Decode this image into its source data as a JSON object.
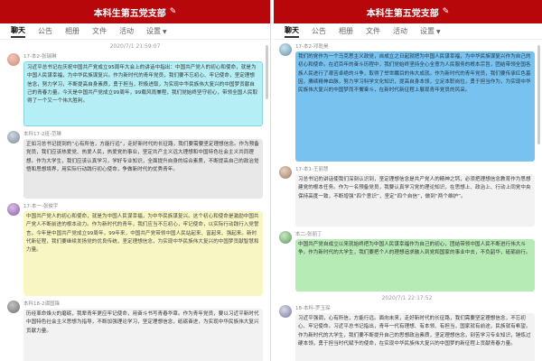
{
  "left": {
    "title": "本科生第五党支部",
    "tabs": [
      "聊天",
      "公告",
      "相册",
      "文件",
      "活动",
      "设置"
    ],
    "time": "2020/7/1 21:59:07",
    "messages": [
      {
        "sender": "17-本2-张瑞琳",
        "text": "习近平总书记在庆祝中国共产党成立95周年大会上的讲话中指出：中国共产党人的初心和使命，就是为中国人民谋幸福，为中华民族谋复兴。作为新时代的青年党员，我们要不忘初心、牢记使命，坚定理想信念，努力学习，不断提高自身素质，勇于担当，积极进取，为实现中华民族伟大复兴的中国梦贡献自己的青春力量。今天是中国共产党成立99周年，99载风雨兼程，我们党始终坚守初心，带领全国人民取得了一个又一个伟大胜利。"
      },
      {
        "sender": "本科17-2班-范琳",
        "text": "正如习总书记提到的“心有所信，方能行远”，走好新时代的长征路，我们要需要坚定理想信念。作为预备党员，我们应该热爱党、热爱人民，热爱党的事业，坚定共产主义远大理想和中国特色社会主义共同理想。作为大学生，我们应该认真学习，学好专业知识，全面提升自身的综合素质，不断提高自己的政治觉悟和思想境界，用实际行动践行初心使命，争做新时代的优秀青年。"
      },
      {
        "sender": "17-本一-张俊宇",
        "text": "中国共产党人的初心和使命，就是为中国人民谋幸福，为中华民族谋复兴。这个初心和使命是激励中国共产党人不断前进的根本动力。作为新时代的青年，我们应当不忘初心，牢记使命，以实际行动践行入党誓言。今年是中国共产党成立99周年，99年来，中国共产党带领中国人民站起来、富起来、强起来。新时代新征程，我们要继续发扬党的优良传统，坚定理想信念，为实现中华民族伟大复兴的中国梦贡献智慧和力量。"
      },
      {
        "sender": "本科18-2谭国锋",
        "text": "历经革命烽火的磨砺，我辈青年更应牢记使命，用奋斗书写青春华章。作为青年党员，要以习近平新时代中国特色社会主义思想为指导，不断加强理论学习，坚定理想信念，砥砺奋进，为实现中华民族伟大复兴贡献力量。"
      }
    ]
  },
  "right": {
    "title": "本科生第五党支部",
    "tabs": [
      "聊天",
      "公告",
      "相册",
      "文件",
      "活动",
      "设置"
    ],
    "time": "2020/7/1 22:17:52",
    "messages": [
      {
        "sender": "17-本2-邓乾昊",
        "text": "我们的党作为一个马克思主义政党，自成立之日起就把为中国人民谋幸福，为中华民族谋复兴作为自己的初心和使命。在近百年的奋斗历程中，我们党始终坚持全心全意为人民服务的根本宗旨，团结带领全国各族人民进行了艰苦卓绝的斗争，取得了举世瞩目的伟大成就。作为新时代的青年党员，我们要传承红色基因，赓续精神血脉，努力学习科学文化知识，提高自身本领，立足本职岗位，勇于担当作为，为实现中华民族伟大复兴的中国梦而不懈奋斗，在新时代新征程上展现青年党员的风采。"
      },
      {
        "sender": "17-本1-王丽慧",
        "text": "习总书记的讲话使我们深刻认识到，坚定理想信念是共产党人的精神之钙，必须把理想信念教育作为思想建党的根本任务。作为一名预备党员，我要认真学习党的理论知识，在思想上、政治上、行动上同党中央保持高度一致，不断增强“四个意识”，坚定“四个自信”，做到“两个维护”。"
      },
      {
        "sender": "本二-张丽丁",
        "text": "中国共产党自成立以来就始终把为中国人民谋幸福作为自己的初心，团结带领中国人民不断进行伟大斗争。作为新时代的大学生，我们要把个人的理想追求融入到党和国家的事业中去，不负韶华，砥砺前行。"
      },
      {
        "sender": "18-本科-罗玉琛",
        "text": "习近平强调，心有所信，方能行远。面向未来，走好新时代的长征路，我们需要坚定理想信念，不忘初心、牢记使命。习近平总书记指出，青年一代有理想、有本领、有担当，国家就有前途，民族就有希望。作为新时代的大学生，我们要不断提升自己的思想政治素质，坚定理想信念，刻苦学习专业知识，锤炼过硬本领，勇于担当时代赋予的使命，在实现中华民族伟大复兴的中国梦的新征程上贡献青春力量。"
      }
    ]
  }
}
